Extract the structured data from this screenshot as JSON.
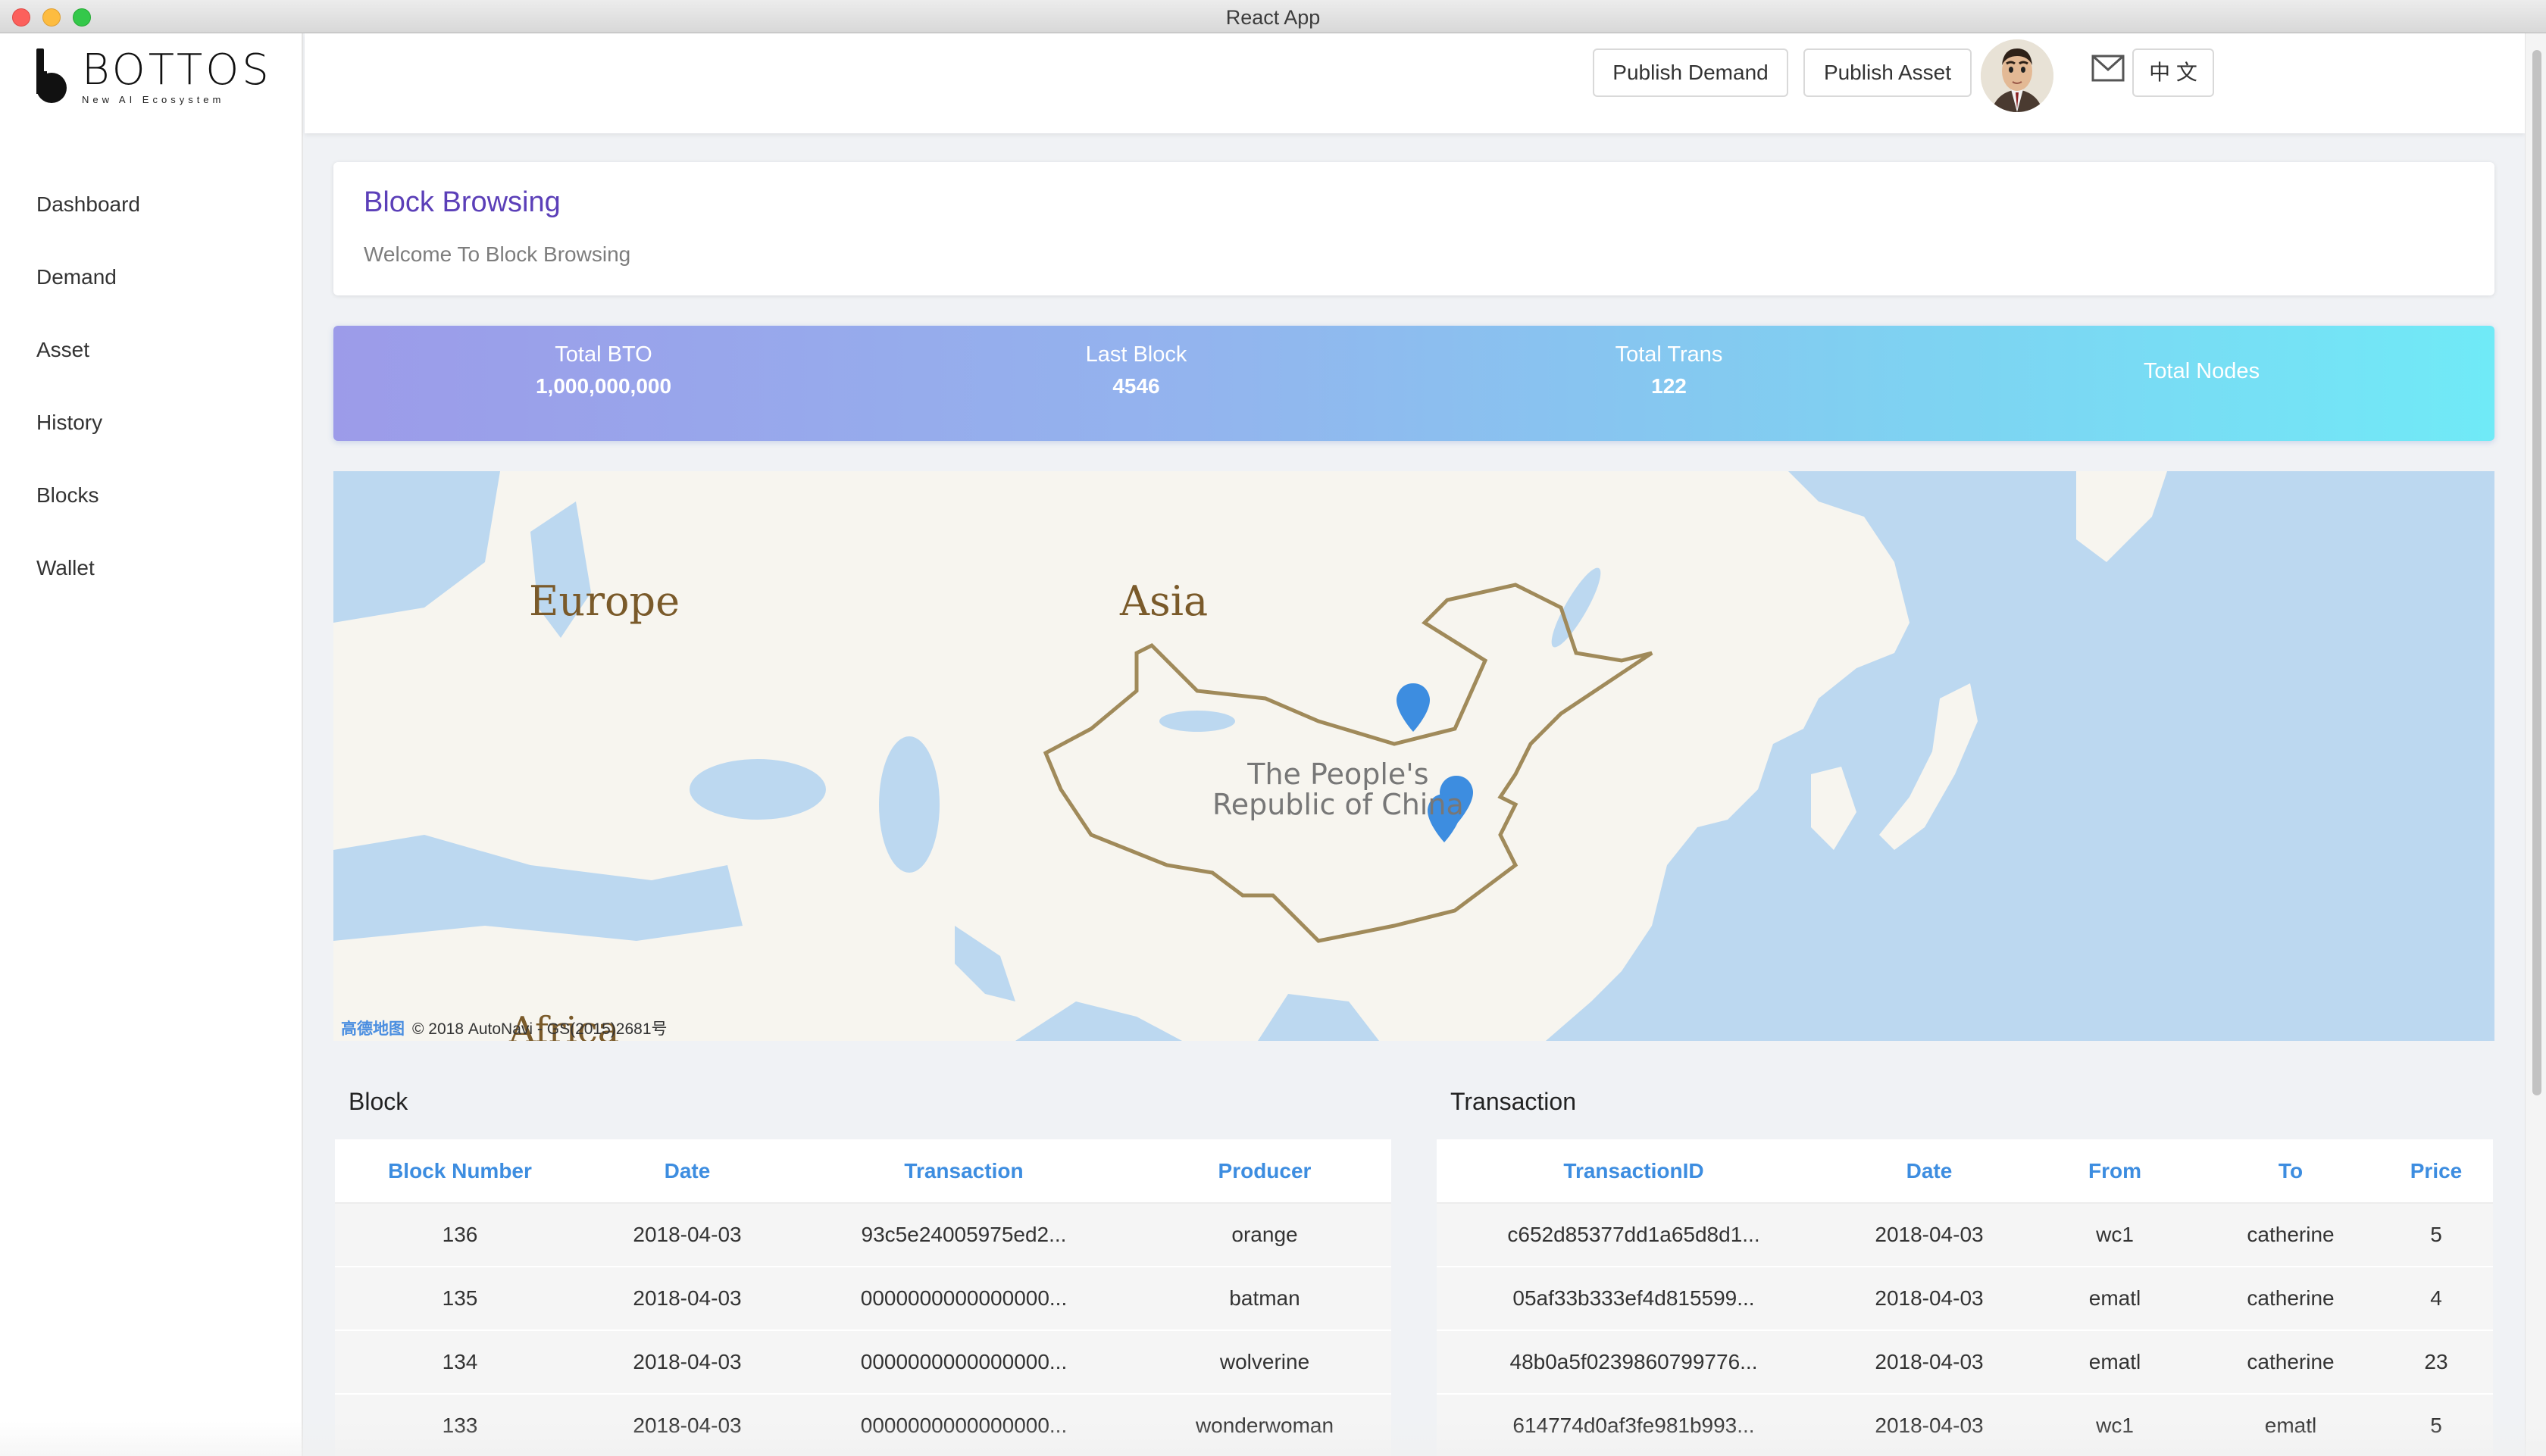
{
  "window": {
    "title": "React App"
  },
  "logo": {
    "brand": "BOTTOS",
    "tagline": "New AI Ecosystem"
  },
  "sidebar": {
    "items": [
      {
        "label": "Dashboard"
      },
      {
        "label": "Demand"
      },
      {
        "label": "Asset"
      },
      {
        "label": "History"
      },
      {
        "label": "Blocks"
      },
      {
        "label": "Wallet"
      }
    ]
  },
  "header": {
    "publish_demand": "Publish Demand",
    "publish_asset": "Publish Asset",
    "language": "中 文",
    "icons": [
      "avatar",
      "mail-icon"
    ]
  },
  "page": {
    "title": "Block Browsing",
    "subtitle": "Welcome To Block Browsing"
  },
  "stats": {
    "total_bto": {
      "label": "Total BTO",
      "value": "1,000,000,000"
    },
    "last_block": {
      "label": "Last Block",
      "value": "4546"
    },
    "total_trans": {
      "label": "Total Trans",
      "value": "122"
    },
    "total_nodes": {
      "label": "Total Nodes"
    }
  },
  "map": {
    "labels": {
      "europe": "Europe",
      "asia": "Asia",
      "africa": "Africa",
      "china_line1": "The People's",
      "china_line2": "Republic of China"
    },
    "credit_brand": "高德地图",
    "credit_text": "© 2018 AutoNavi - GS(2015)2681号",
    "colors": {
      "water": "#bcd8f0",
      "land": "#f7f5ef",
      "marker": "#3d8de0"
    }
  },
  "block_table": {
    "title": "Block",
    "columns": [
      "Block Number",
      "Date",
      "Transaction",
      "Producer"
    ],
    "rows": [
      [
        "136",
        "2018-04-03",
        "93c5e24005975ed2...",
        "orange"
      ],
      [
        "135",
        "2018-04-03",
        "0000000000000000...",
        "batman"
      ],
      [
        "134",
        "2018-04-03",
        "0000000000000000...",
        "wolverine"
      ],
      [
        "133",
        "2018-04-03",
        "0000000000000000...",
        "wonderwoman"
      ]
    ]
  },
  "transaction_table": {
    "title": "Transaction",
    "columns": [
      "TransactionID",
      "Date",
      "From",
      "To",
      "Price"
    ],
    "rows": [
      [
        "c652d85377dd1a65d8d1...",
        "2018-04-03",
        "wc1",
        "catherine",
        "5"
      ],
      [
        "05af33b333ef4d815599...",
        "2018-04-03",
        "ematl",
        "catherine",
        "4"
      ],
      [
        "48b0a5f0239860799776...",
        "2018-04-03",
        "ematl",
        "catherine",
        "23"
      ],
      [
        "614774d0af3fe981b993...",
        "2018-04-03",
        "wc1",
        "ematl",
        "5"
      ]
    ]
  }
}
